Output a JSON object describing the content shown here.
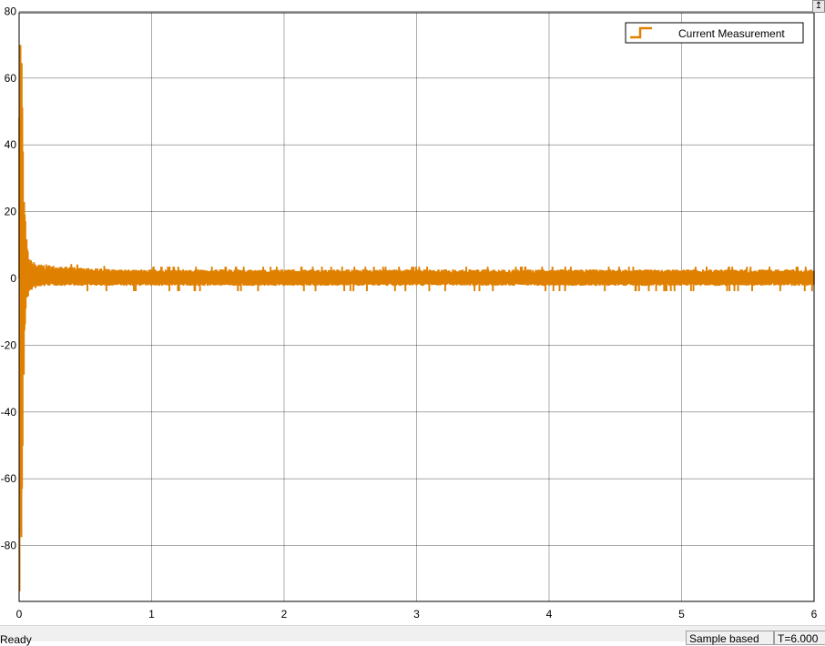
{
  "colors": {
    "signal": "#e08000",
    "grid": "#000000",
    "background": "#ffffff",
    "statusbar": "#f0f0f0"
  },
  "status": {
    "ready": "Ready",
    "mode": "Sample based",
    "time": "T=6.000"
  },
  "dock_icon": "undock-arrow-icon",
  "chart_data": {
    "type": "line",
    "title": "",
    "xlabel": "",
    "ylabel": "",
    "xlim": [
      0,
      6
    ],
    "ylim": [
      -97,
      80
    ],
    "x_ticks": [
      0,
      1,
      2,
      3,
      4,
      5,
      6
    ],
    "y_ticks": [
      80,
      60,
      40,
      20,
      0,
      -20,
      -40,
      -60,
      -80
    ],
    "grid": true,
    "legend_position": "top-right",
    "series": [
      {
        "name": "Current Measurement",
        "color": "#e08000",
        "style": "stairs",
        "envelope": {
          "t": [
            0,
            0.01,
            0.02,
            0.03,
            0.05,
            0.07,
            0.1,
            0.15,
            0.2,
            0.3,
            0.5,
            0.8,
            1.0,
            2.0,
            3.0,
            4.0,
            5.0,
            6.0
          ],
          "upper": [
            80,
            78,
            70,
            32,
            14,
            6,
            5,
            4,
            4,
            3.5,
            3,
            2.5,
            2.5,
            2.5,
            2.5,
            2.5,
            2.5,
            2.5
          ],
          "lower": [
            -97,
            -95,
            -80,
            -40,
            -7,
            -5,
            -3,
            -2.5,
            -2,
            -2,
            -2,
            -2,
            -2,
            -2,
            -2,
            -2,
            -2,
            -2
          ]
        },
        "notes": "High-frequency oscillation; large transient near t=0, then settles to about ±2.5 around 0"
      }
    ]
  }
}
